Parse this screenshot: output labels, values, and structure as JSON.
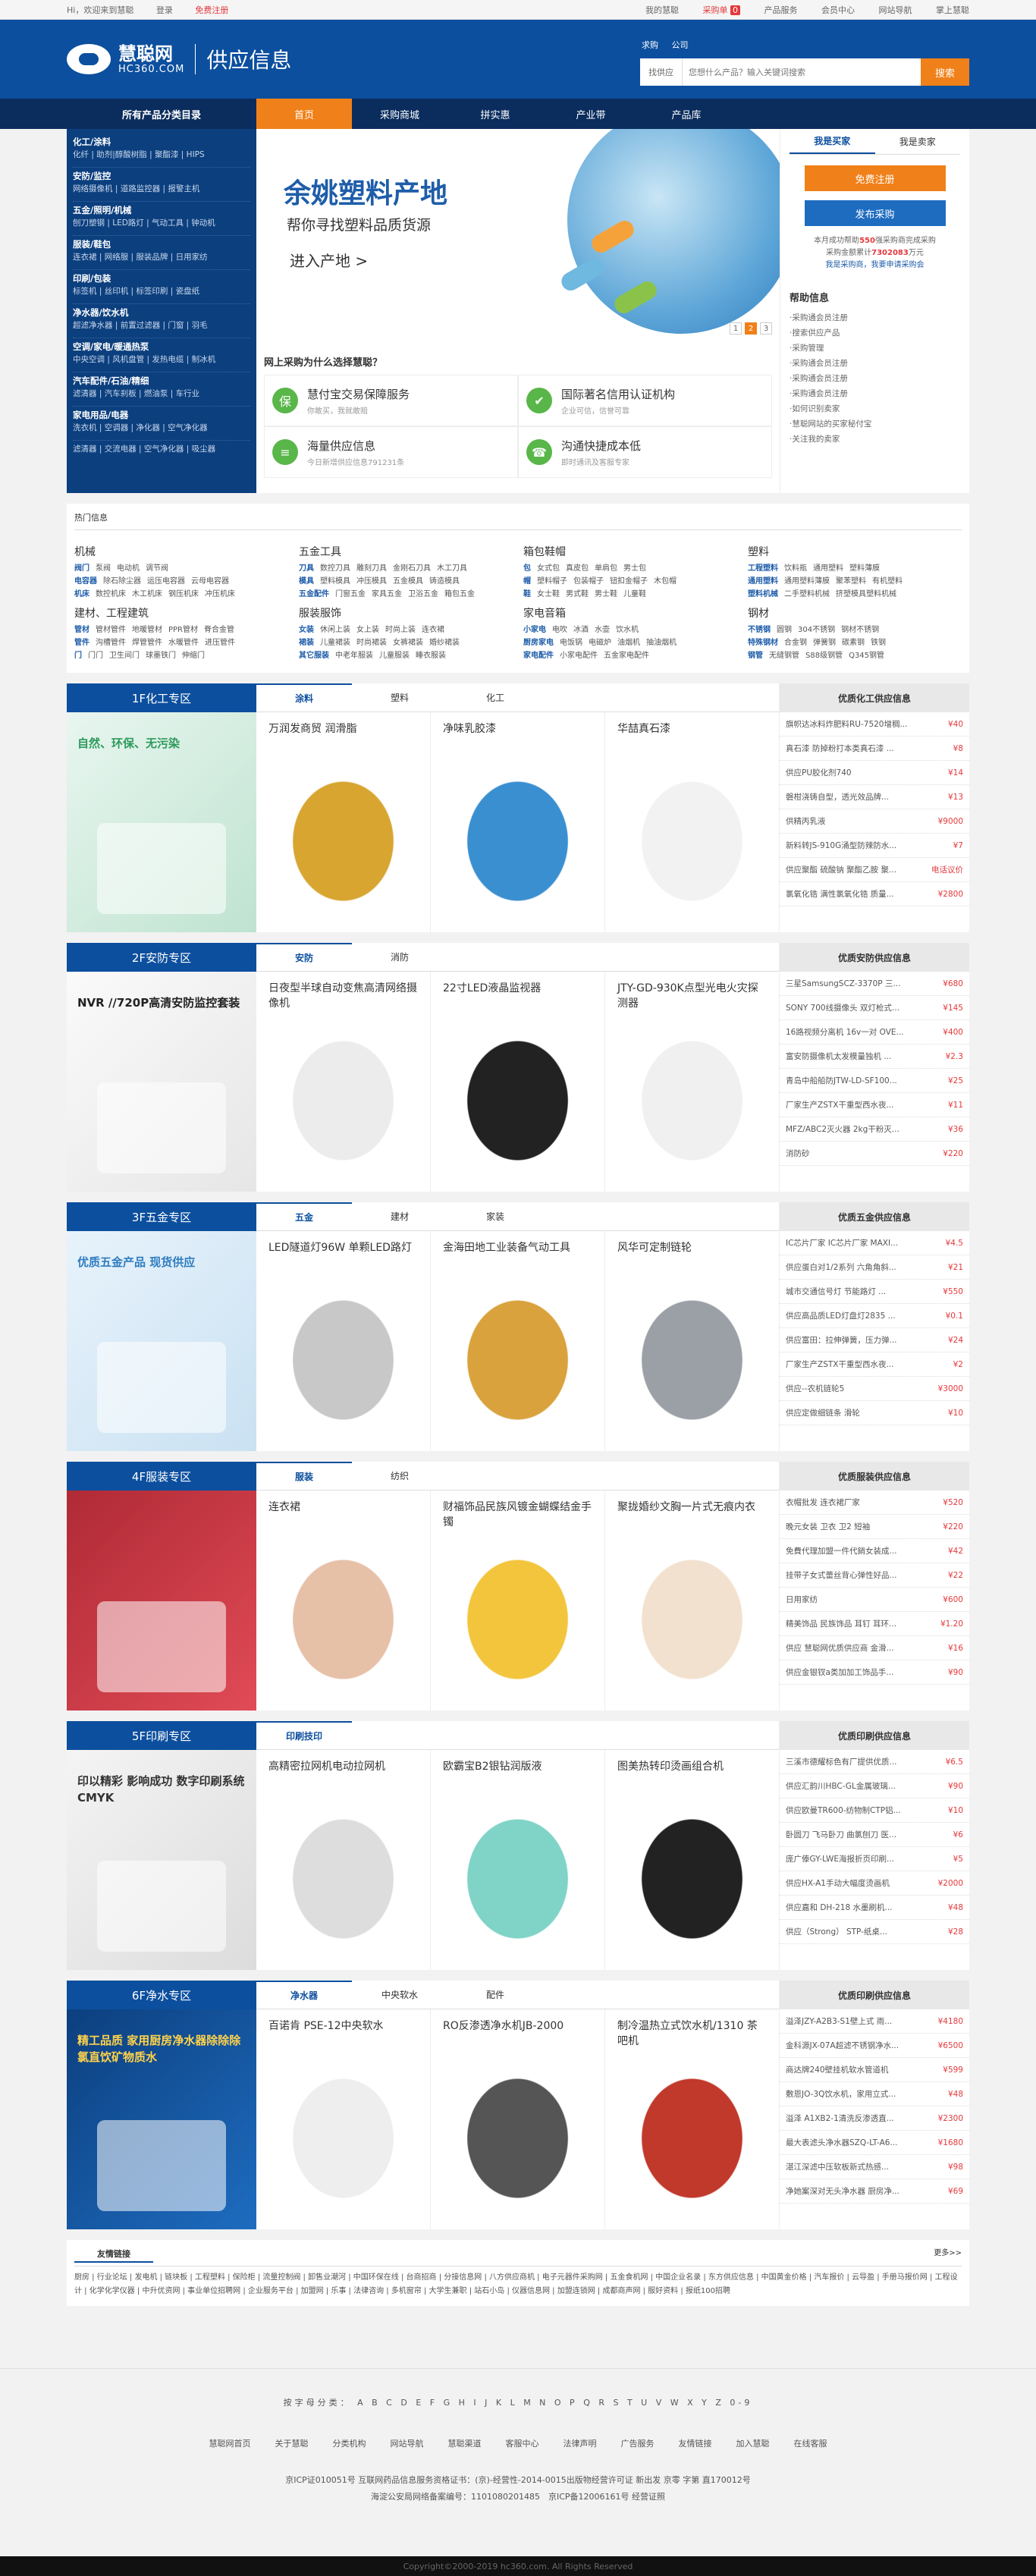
{
  "topbar": {
    "hi": "Hi，欢迎来到慧聪",
    "login": "登录",
    "register": "免费注册",
    "my": "我的慧聪",
    "purchase": "采购单",
    "purchase_count": "0",
    "product_service": "产品服务",
    "members": "会员中心",
    "nav": "网站导航",
    "mobile": "掌上慧聪"
  },
  "header": {
    "logo_cn": "慧聪网",
    "logo_en": "HC360.COM",
    "title": "供应信息",
    "search_tab1": "求购",
    "search_tab2": "公司",
    "search_cat": "找供应",
    "search_placeholder": "您想什么产品？输入关键词搜索",
    "search_btn": "搜索"
  },
  "nav": {
    "all": "所有产品分类目录",
    "items": [
      "首页",
      "采购商城",
      "拼实惠",
      "产业带",
      "产品库"
    ]
  },
  "categories": [
    {
      "title": "化工/涂料",
      "sub": "化纤 | 助剂|醇酸树脂 | 聚酯漆 | HIPS"
    },
    {
      "title": "安防/监控",
      "sub": "网络摄像机 | 道路监控器 | 报警主机"
    },
    {
      "title": "五金/照明/机械",
      "sub": "刨刀塑钢 | LED路灯 | 气动工具 | 钟动机"
    },
    {
      "title": "服装/鞋包",
      "sub": "连衣裙 | 网络服 | 服装品牌 | 日用家纺"
    },
    {
      "title": "印刷/包装",
      "sub": "标签机 | 丝印机 | 标签印刷 | 瓷盘纸"
    },
    {
      "title": "净水器/饮水机",
      "sub": "超滤净水器 | 前置过滤器 | 门窗 | 羽毛"
    },
    {
      "title": "空调/家电/暖通热泵",
      "sub": "中央空调 | 风机盘管 | 发热电缆 | 制冰机"
    },
    {
      "title": "汽车配件/石油/精细",
      "sub": "滤清器 | 汽车刹板 | 燃油泵 | 车行业"
    },
    {
      "title": "家电用品/电器",
      "sub": "洗衣机 | 空调器 | 净化器 | 空气净化器"
    },
    {
      "title": "",
      "sub": "滤清器 | 交流电器 | 空气净化器 | 吸尘器"
    }
  ],
  "banner": {
    "h1": "余姚塑料产地",
    "h2": "帮你寻找塑料品质货源",
    "h3": "进入产地 >",
    "dots": [
      "1",
      "2",
      "3"
    ]
  },
  "why": {
    "question": "网上采购为什么选择慧聪？",
    "items": [
      {
        "icon": "保",
        "title": "慧付宝交易保障服务",
        "sub": "你敢买，我就敢赔"
      },
      {
        "icon": "✔",
        "title": "国际著名信用认证机构",
        "sub": "企业可信，信誉可靠"
      },
      {
        "icon": "≡",
        "title": "海量供应信息",
        "sub": "今日新增供应信息791231条"
      },
      {
        "icon": "☎",
        "title": "沟通快捷成本低",
        "sub": "即时通讯及客服专家"
      }
    ]
  },
  "side": {
    "tab1": "我是买家",
    "tab2": "我是卖家",
    "btn1": "免费注册",
    "btn2": "发布采购",
    "stat1": "本月成功帮助",
    "stat_n1": "550",
    "stat2": "强采购商完成采购",
    "stat3": "采购金额累计",
    "stat_n2": "7302083",
    "stat4": "万元",
    "stat5": "我是采购商，我要申请采购会",
    "help_title": "帮助信息",
    "help_items": [
      "采购通会员注册",
      "搜索供应产品",
      "采购管理",
      "采购通会员注册",
      "采购通会员注册",
      "采购通会员注册",
      "如何识别卖家",
      "慧聪网站的买家秘付宝",
      "关注我的卖家"
    ]
  },
  "hot": {
    "title": "热门信息",
    "cols": [
      {
        "h": "机械",
        "lines": [
          [
            "阀门",
            "泵阀",
            "电动机",
            "调节阀"
          ],
          [
            "电容器",
            "除石除尘器",
            "运压电容器",
            "云母电容器"
          ],
          [
            "机床",
            "数控机床",
            "木工机床",
            "钢压机床",
            "冲压机床"
          ]
        ]
      },
      {
        "h": "五金工具",
        "lines": [
          [
            "刀具",
            "数控刀具",
            "雕刻刀具",
            "金刚石刀具",
            "木工刀具"
          ],
          [
            "模具",
            "塑料模具",
            "冲压模具",
            "五金模具",
            "铸造模具"
          ],
          [
            "五金配件",
            "门窗五金",
            "家具五金",
            "卫浴五金",
            "箱包五金"
          ]
        ]
      },
      {
        "h": "箱包鞋帽",
        "lines": [
          [
            "包",
            "女式包",
            "真皮包",
            "单肩包",
            "男士包"
          ],
          [
            "帽",
            "塑料帽子",
            "包装帽子",
            "钮扣金帽子",
            "木包帽"
          ],
          [
            "鞋",
            "女士鞋",
            "男式鞋",
            "男士鞋",
            "儿童鞋"
          ]
        ]
      },
      {
        "h": "塑料",
        "lines": [
          [
            "工程塑料",
            "饮料瓶",
            "通用塑料",
            "塑料薄膜"
          ],
          [
            "通用塑料",
            "通用塑料薄膜",
            "聚苯塑料",
            "有机塑料"
          ],
          [
            "塑料机械",
            "二手塑料机械",
            "挤塑模具塑料机械"
          ]
        ]
      },
      {
        "h": "建材、工程建筑",
        "lines": [
          [
            "管材",
            "管材管件",
            "地暖管材",
            "PPR管材",
            "脊合金管"
          ],
          [
            "管件",
            "沟槽管件",
            "焊管管件",
            "水暖管件",
            "进压管件"
          ],
          [
            "门",
            "门门",
            "卫生间门",
            "球墨铁门",
            "伸缩门"
          ]
        ]
      },
      {
        "h": "服装服饰",
        "lines": [
          [
            "女装",
            "休闲上装",
            "女上装",
            "时尚上装",
            "连衣裙"
          ],
          [
            "裙装",
            "儿童裙装",
            "时尚裙装",
            "女裤裙装",
            "婚纱裙装"
          ],
          [
            "其它服装",
            "中老年服装",
            "儿童服装",
            "睡衣服装"
          ]
        ]
      },
      {
        "h": "家电音箱",
        "lines": [
          [
            "小家电",
            "电吹",
            "冰酒",
            "水壶",
            "饮水机"
          ],
          [
            "厨房家电",
            "电饭锅",
            "电磁炉",
            "油烟机",
            "抽油烟机"
          ],
          [
            "家电配件",
            "小家电配件",
            "五金家电配件"
          ]
        ]
      },
      {
        "h": "钢材",
        "lines": [
          [
            "不锈钢",
            "圆钢",
            "304不锈钢",
            "钢材不锈钢"
          ],
          [
            "特殊钢材",
            "合金钢",
            "弹簧钢",
            "碳素钢",
            "铁钢"
          ],
          [
            "钢管",
            "无缝钢管",
            "S88级钢管",
            "Q345钢管"
          ]
        ]
      }
    ]
  },
  "floors": [
    {
      "title": "1F化工专区",
      "tabs": [
        "涂料",
        "塑料",
        "化工"
      ],
      "promo": "自然、环保、无污染",
      "products": [
        "万润发商贸 润滑脂",
        "净味乳胶漆",
        "华喆真石漆"
      ],
      "right_title": "优质化工供应信息",
      "rows": [
        [
          "旗帜达冰料炸肥料RU-7520增稠...",
          "¥40"
        ],
        [
          "真石漆 防掉粉打本类真石漆 ...",
          "¥8"
        ],
        [
          "供应PU胶化剂740",
          "¥14"
        ],
        [
          "磐柑浇铸自型，透光效品牌...",
          "¥13"
        ],
        [
          "供精丙乳液",
          "¥9000"
        ],
        [
          "新料转JS-910G涌型防辣防水...",
          "¥7"
        ],
        [
          "供应聚酯 硫酸钠 聚酯乙胺 聚...",
          "电话议价"
        ],
        [
          "氯氧化锆 满性氯氧化锆 质量...",
          "¥2800"
        ]
      ]
    },
    {
      "title": "2F安防专区",
      "tabs": [
        "安防",
        "消防"
      ],
      "promo": "NVR //720P高清安防监控套装",
      "products": [
        "日夜型半球自动变焦高清网络摄像机",
        "22寸LED液晶监视器",
        "JTY-GD-930K点型光电火灾探测器"
      ],
      "right_title": "优质安防供应信息",
      "rows": [
        [
          "三星SamsungSCZ-3370P 三...",
          "¥680"
        ],
        [
          "SONY 700线摄像头 双灯枪式...",
          "¥145"
        ],
        [
          "16路视频分离机 16v一对 OVE...",
          "¥400"
        ],
        [
          "富安防摄像机太发模量独机 ...",
          "¥2.3"
        ],
        [
          "青岛中船船防JTW-LD-SF100...",
          "¥25"
        ],
        [
          "厂家生产ZSTX干重型西水夜...",
          "¥11"
        ],
        [
          "MFZ/ABC2灭火器 2kg干粉灭...",
          "¥36"
        ],
        [
          "消防砂",
          "¥220"
        ]
      ]
    },
    {
      "title": "3F五金专区",
      "tabs": [
        "五金",
        "建材",
        "家装"
      ],
      "promo": "优质五金产品 现货供应",
      "products": [
        "LED隧道灯96W 单颗LED路灯",
        "金海田地工业装备气动工具",
        "风华可定制链轮"
      ],
      "right_title": "优质五金供应信息",
      "rows": [
        [
          "IC芯片厂家 IC芯片厂家 MAXI...",
          "¥4.5"
        ],
        [
          "供应蛋白对1/2系列 六角角斜...",
          "¥21"
        ],
        [
          "城市交通信号灯 节能路灯 ...",
          "¥550"
        ],
        [
          "供应高品质LED灯盘灯2835 ...",
          "¥0.1"
        ],
        [
          "供应富田：拉伸弹簧，压力弹...",
          "¥24"
        ],
        [
          "厂家生产ZSTX干重型西水夜...",
          "¥2"
        ],
        [
          "供应--农机链轮5",
          "¥3000"
        ],
        [
          "供应定做细链条 滑轮",
          "¥10"
        ]
      ]
    },
    {
      "title": "4F服装专区",
      "tabs": [
        "服装",
        "纺织"
      ],
      "promo": "",
      "products": [
        "连衣裙",
        "财福饰品民族风镀金蝴蝶结金手镯",
        "聚拢婚纱文胸一片式无痕内衣"
      ],
      "right_title": "优质服装供应信息",
      "rows": [
        [
          "衣帽批发 连衣裙厂家",
          "¥520"
        ],
        [
          "晚元女装 卫衣 卫2 短袖",
          "¥220"
        ],
        [
          "免費代理加盟一件代銷女装成...",
          "¥42"
        ],
        [
          "挂带子女式蕾丝背心弹性好品...",
          "¥22"
        ],
        [
          "日用家纺",
          "¥600"
        ],
        [
          "精美饰品 民族饰品 耳钉 耳环...",
          "¥1.20"
        ],
        [
          "供应 慧聪网优质供应商 金滑...",
          "¥16"
        ],
        [
          "供应金银钗a类加加工饰品手...",
          "¥90"
        ]
      ]
    },
    {
      "title": "5F印刷专区",
      "tabs": [
        "印刷技印"
      ],
      "promo": "印以精彩 影响成功 数字印刷系统 CMYK",
      "products": [
        "高精密拉网机电动拉网机",
        "欧霸宝B2银钻润版液",
        "图美热转印烫画组合机"
      ],
      "right_title": "优质印刷供应信息",
      "rows": [
        [
          "三溪市德耀标色有厂提供优质...",
          "¥6.5"
        ],
        [
          "供应汇韵川HBC-GL金属玻璃...",
          "¥90"
        ],
        [
          "供应欧曼TR600-纺物制CTP铝...",
          "¥10"
        ],
        [
          "卧圆刀 飞马卧刀 曲氯刨刀 医...",
          "¥6"
        ],
        [
          "庞广傣GY-LWE海报折页印刷...",
          "¥5"
        ],
        [
          "供应HX-A1手动大幅度烫画机",
          "¥2000"
        ],
        [
          "供应嘉和 DH-218 水墨刷机...",
          "¥48"
        ],
        [
          "供应（Strong） STP-纸桌...",
          "¥28"
        ]
      ]
    },
    {
      "title": "6F净水专区",
      "tabs": [
        "净水器",
        "中央软水",
        "配件"
      ],
      "promo": "精工品质 家用厨房净水器除除除氯直饮矿物质水",
      "products": [
        "百诺肯 PSE-12中央软水",
        "RO反渗透净水机JB-2000",
        "制冷温热立式饮水机/1310 茶吧机"
      ],
      "right_title": "优质印刷供应信息",
      "rows": [
        [
          "溢泽JZY-A2B3-S1壁上式 雨...",
          "¥4180"
        ],
        [
          "金科源JX-07A超滤不锈钢净水...",
          "¥6500"
        ],
        [
          "商达牌240壁挂机软水管道机",
          "¥599"
        ],
        [
          "敷恩JO-3Q饮水机，家用立式...",
          "¥48"
        ],
        [
          "溢泽 A1XB2-1清洗反渗透直...",
          "¥2300"
        ],
        [
          "最大表滤头净水器SZQ-LT-A6...",
          "¥1680"
        ],
        [
          "湛江深滤中压软板新式热感...",
          "¥98"
        ],
        [
          "净她案深对无头净水器 厨房净...",
          "¥69"
        ]
      ]
    }
  ],
  "links": {
    "title": "友情链接",
    "more": "更多>>",
    "text": "厨房 | 行业论坛 | 发电机 | 链块板 | 工程塑料 | 保险柜 | 流量控制阀 | 卸售业潮河 | 中国环保在线 | 台商招商 | 分接信息网 | 八方供应商机 | 电子元器件采购网 | 五金食机网 | 中国企业名录 | 东方供应信息 | 中国黄金价格 | 汽车报价 | 云导盈 | 手册马报价网 | 工程设计 | 化学化学仪器 | 中升优资网 | 事业单位招聘网 | 企业服务平台 | 加盟网 | 乐事 | 法律咨询 | 多机窗帘 | 大学生兼职 | 站石小岛 | 仪器信息网 | 加盟连锁网 | 成都商声网 | 服好资料 | 报纸100招聘"
  },
  "footer": {
    "az_label": "按字母分类：",
    "az": "A B C D E F G H I J K L M N O P Q R S T U V W X Y Z 0-9",
    "links": [
      "慧聪网首页",
      "关于慧聪",
      "分类机构",
      "网站导航",
      "慧聪渠道",
      "客服中心",
      "法律声明",
      "广告服务",
      "友情链接",
      "加入慧聪",
      "在线客服"
    ],
    "cp1": "京ICP证010051号 互联网药品信息服务资格证书：(京)-经营性-2014-0015出版物经营许可证 新出发 京零 字第 直170012号",
    "cp2": "海淀公安局网络备案编号：1101080201485　京ICP备12006161号 经营证照",
    "copyright": "Copyright©2000-2019 hc360.com. All Rights Reserved"
  }
}
